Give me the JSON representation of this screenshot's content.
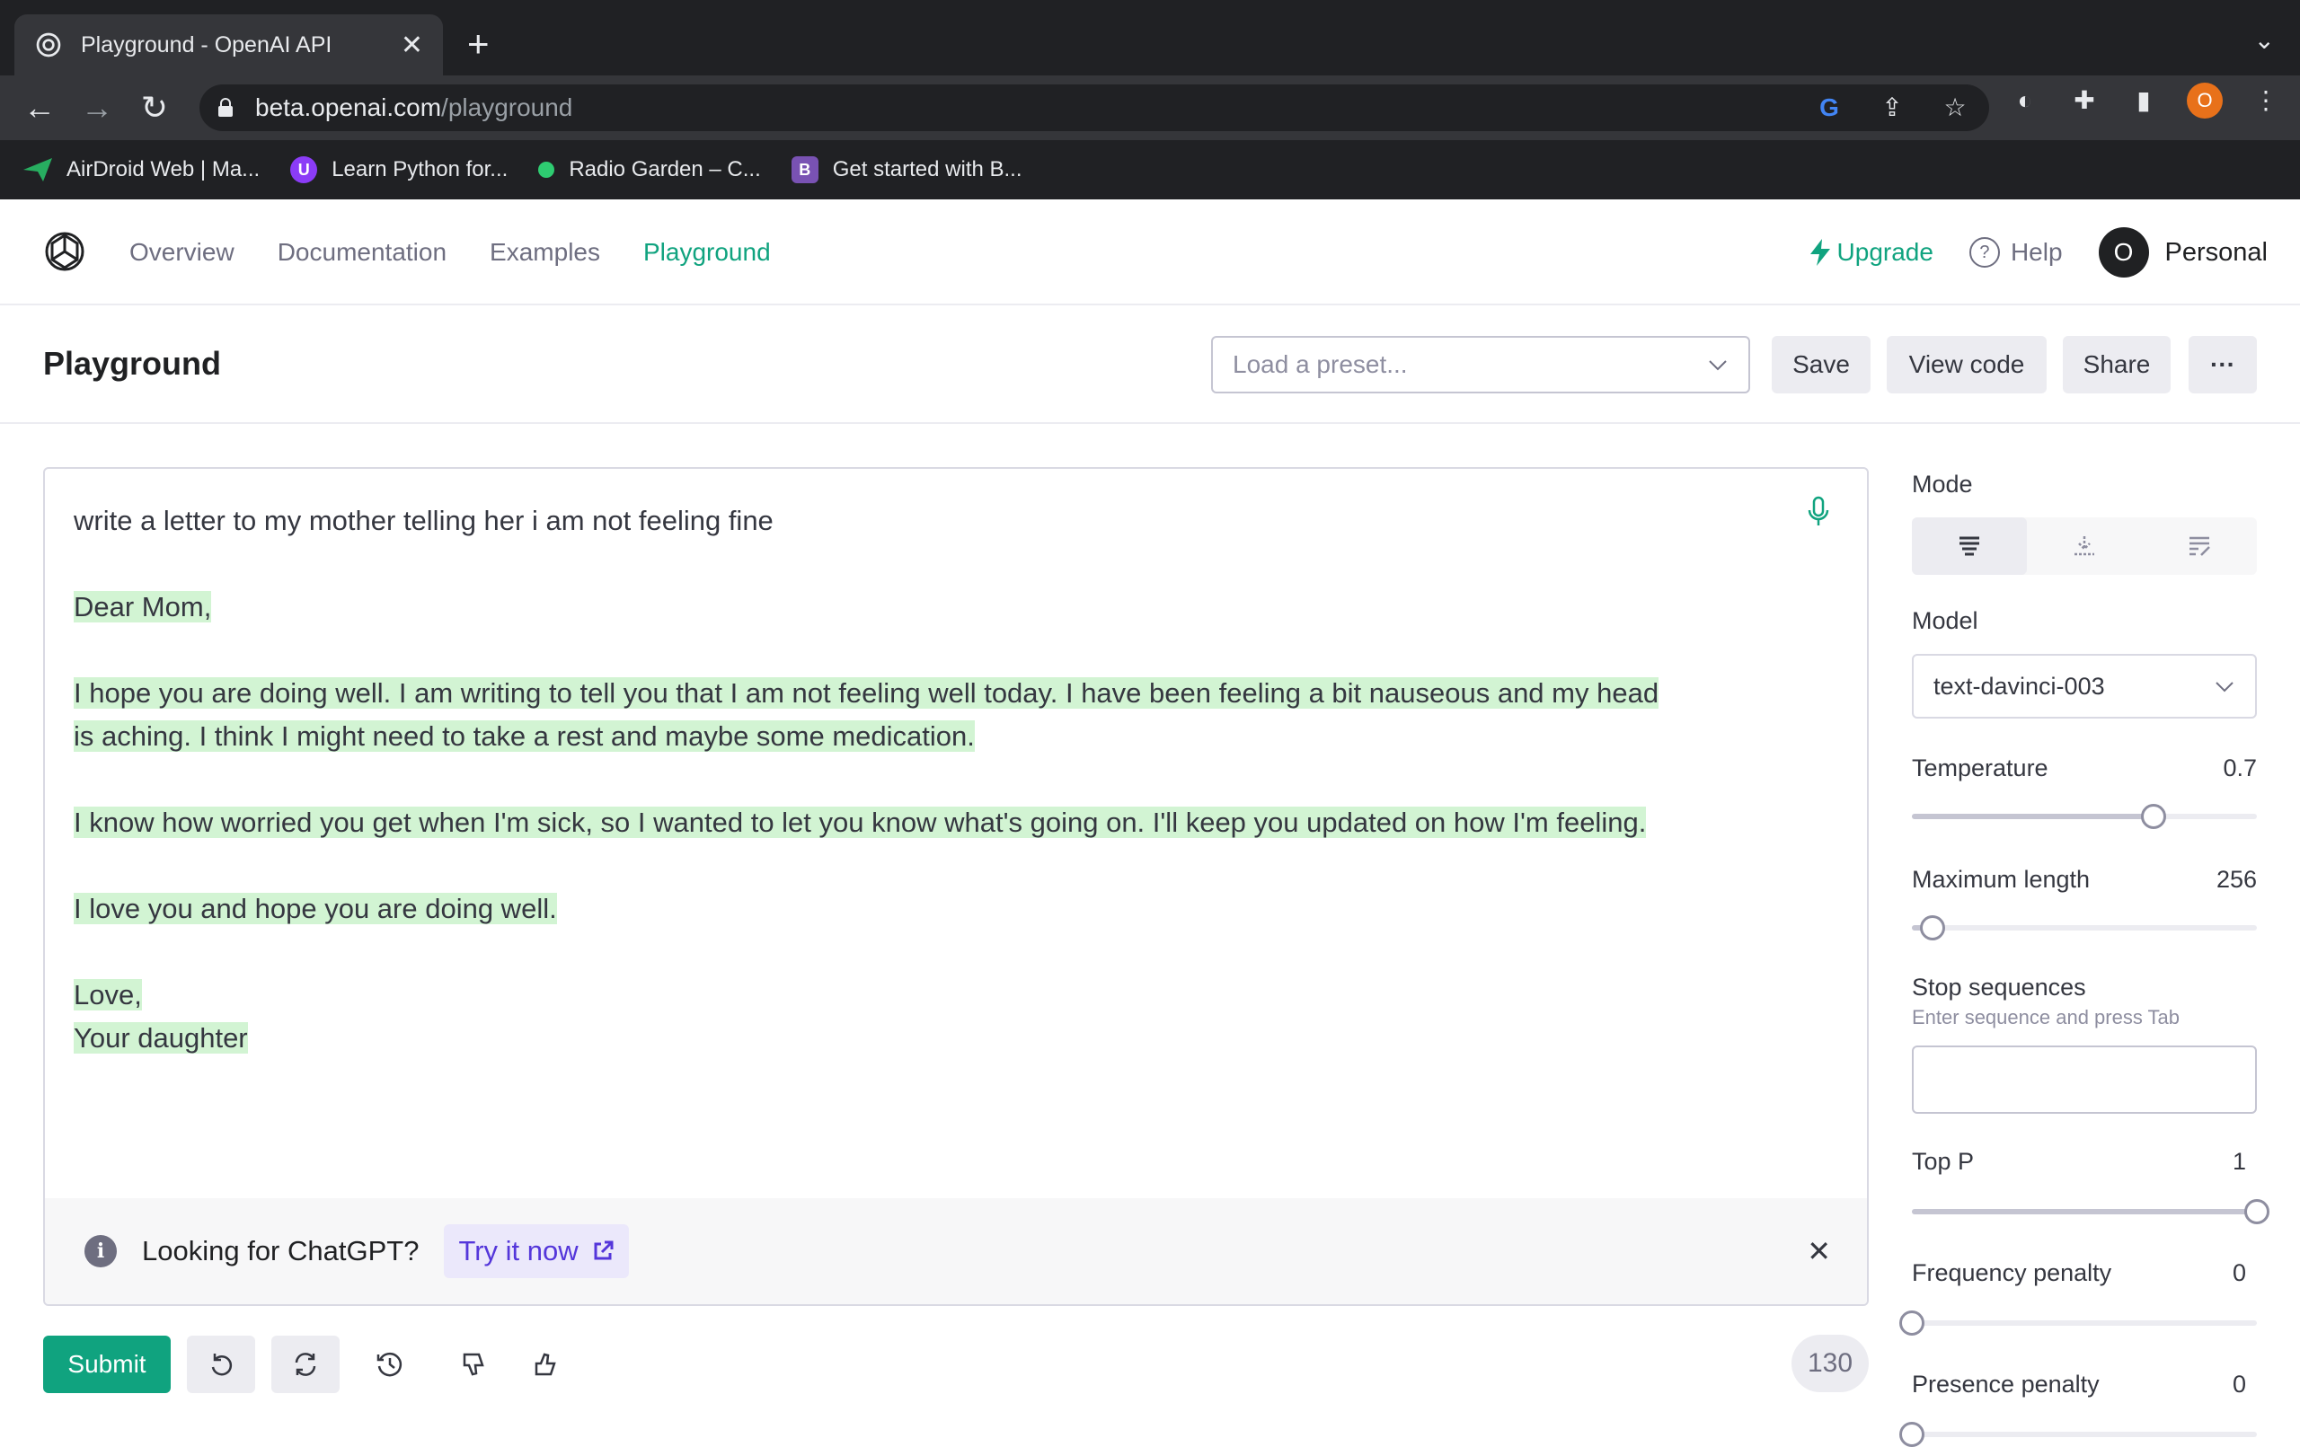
{
  "browser": {
    "tab_title": "Playground - OpenAI API",
    "url_domain": "beta.openai.com",
    "url_path": "/playground",
    "profile_initial": "O",
    "bookmarks": [
      {
        "label": "AirDroid Web | Ma...",
        "icon": "airdroid-icon",
        "color": "#27ae60"
      },
      {
        "label": "Learn Python for...",
        "icon": "shield-u-icon",
        "color": "#8b3cf7"
      },
      {
        "label": "Radio Garden – C...",
        "icon": "green-dot-icon",
        "color": "#2ecc71"
      },
      {
        "label": "Get started with B...",
        "icon": "bootstrap-icon",
        "color": "#7952b3"
      }
    ]
  },
  "nav": {
    "links": [
      "Overview",
      "Documentation",
      "Examples",
      "Playground"
    ],
    "active": "Playground",
    "upgrade": "Upgrade",
    "help": "Help",
    "avatar_initial": "O",
    "account": "Personal"
  },
  "header": {
    "title": "Playground",
    "preset_placeholder": "Load a preset...",
    "save": "Save",
    "view_code": "View code",
    "share": "Share",
    "more": "···"
  },
  "editor": {
    "prompt": "write a letter to my mother telling her i am not feeling fine",
    "greeting": "Dear Mom,",
    "para1_line1": "I hope you are doing well. I am writing to tell you that I am not feeling well today. I have been feeling a bit nauseous and my head",
    "para1_line2": "is aching. I think I might need to take a rest and maybe some medication.",
    "para2": "I know how worried you get when I'm sick, so I wanted to let you know what's going on. I'll keep you updated on how I'm feeling.",
    "para3": "I love you and hope you are doing well.",
    "closing": "Love,",
    "signature": "Your daughter"
  },
  "banner": {
    "text": "Looking for ChatGPT?",
    "link": "Try it now"
  },
  "footer": {
    "submit": "Submit",
    "token_count": "130"
  },
  "settings": {
    "mode_label": "Mode",
    "model_label": "Model",
    "model_value": "text-davinci-003",
    "temperature_label": "Temperature",
    "temperature_value": "0.7",
    "temperature_fraction": 0.7,
    "max_length_label": "Maximum length",
    "max_length_value": "256",
    "max_length_fraction": 0.06,
    "stop_label": "Stop sequences",
    "stop_hint": "Enter sequence and press Tab",
    "top_p_label": "Top P",
    "top_p_value": "1",
    "top_p_fraction": 1.0,
    "freq_label": "Frequency penalty",
    "freq_value": "0",
    "freq_fraction": 0.0,
    "presence_label": "Presence penalty",
    "presence_value": "0",
    "presence_fraction": 0.0
  },
  "colors": {
    "accent": "#10a37f",
    "highlight": "#d2f4d3",
    "link_purple": "#5436da"
  }
}
